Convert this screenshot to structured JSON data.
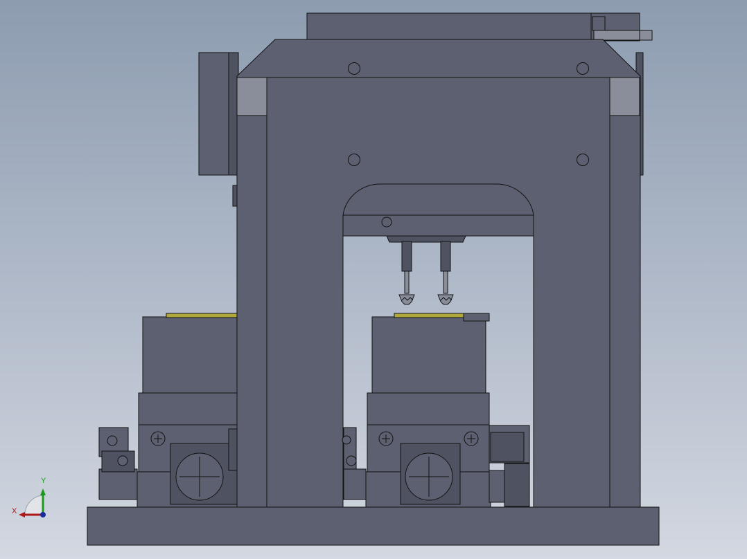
{
  "triad": {
    "x_label": "X",
    "y_label": "Y",
    "x_color": "#b01818",
    "y_color": "#1a9a1a",
    "z_color": "#1a2aa0"
  },
  "colors": {
    "part_fill": "#5c6070",
    "part_dark": "#4f5361",
    "part_light": "#8a8e9b",
    "edge": "#121212",
    "highlight": "#b0a838"
  }
}
